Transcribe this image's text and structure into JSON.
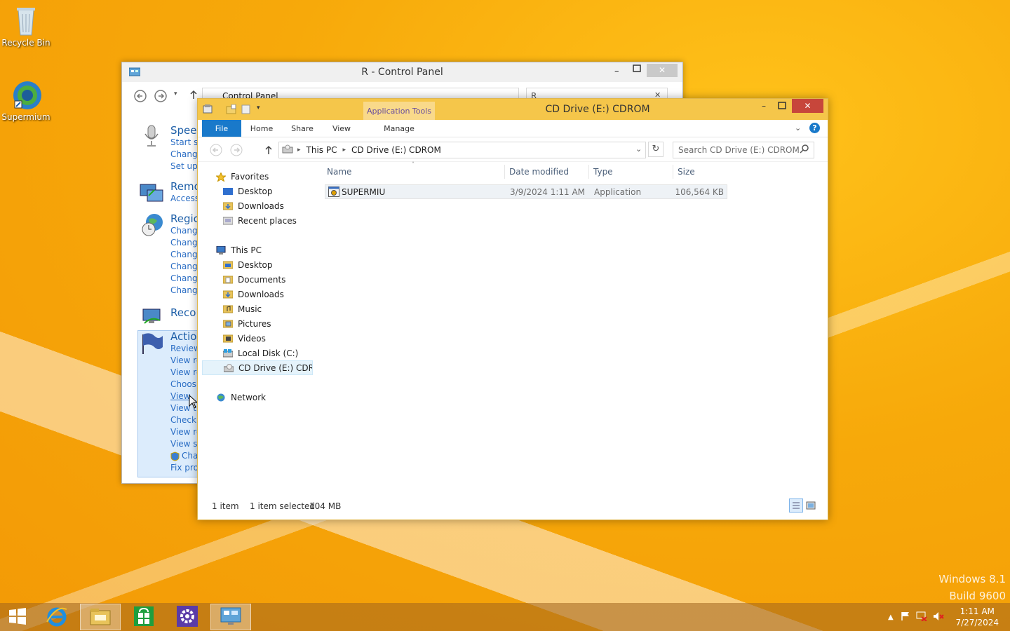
{
  "desktop": {
    "icons": [
      {
        "label": "Recycle Bin"
      },
      {
        "label": "Supermium"
      }
    ],
    "watermark": {
      "line1": "Windows 8.1",
      "line2": "Build 9600"
    }
  },
  "control_panel": {
    "title": "R - Control Panel",
    "breadcrumb": "Control Panel",
    "search_value": "R",
    "groups": [
      {
        "heading": "Speec",
        "links": [
          "Start sp",
          "Chang",
          "Set up"
        ]
      },
      {
        "heading": "Remo",
        "links": [
          "Access"
        ]
      },
      {
        "heading": "Regic",
        "links": [
          "Chang",
          "Chang",
          "Chang",
          "Chang",
          "Chang",
          "Chang"
        ]
      },
      {
        "heading": "Reco",
        "links": []
      },
      {
        "heading": "Actio",
        "links": [
          "Review",
          "View re",
          "View re",
          "Choos",
          "View",
          "View t",
          "Check",
          "View re",
          "View sc",
          "Cha",
          "Fix prol"
        ]
      }
    ]
  },
  "explorer": {
    "title": "CD Drive (E:) CDROM",
    "context_tab": "Application Tools",
    "ribbon_tabs": [
      "File",
      "Home",
      "Share",
      "View",
      "Manage"
    ],
    "address": {
      "root": "This PC",
      "current": "CD Drive (E:) CDROM"
    },
    "search_placeholder": "Search CD Drive (E:) CDROM",
    "nav": {
      "favorites": {
        "label": "Favorites",
        "items": [
          "Desktop",
          "Downloads",
          "Recent places"
        ]
      },
      "this_pc": {
        "label": "This PC",
        "items": [
          "Desktop",
          "Documents",
          "Downloads",
          "Music",
          "Pictures",
          "Videos",
          "Local Disk (C:)",
          "CD Drive (E:) CDROM"
        ]
      },
      "network": {
        "label": "Network"
      }
    },
    "columns": {
      "name": "Name",
      "date": "Date modified",
      "type": "Type",
      "size": "Size"
    },
    "files": [
      {
        "name": "SUPERMIU",
        "date": "3/9/2024 1:11 AM",
        "type": "Application",
        "size": "106,564 KB"
      }
    ],
    "status": {
      "count": "1 item",
      "selected": "1 item selected",
      "size": "104 MB"
    }
  },
  "taskbar": {
    "clock_time": "1:11 AM",
    "clock_date": "7/27/2024"
  },
  "colors": {
    "accent": "#1979ca",
    "title_yellow": "#f5c64a",
    "close_red": "#c7463b"
  }
}
